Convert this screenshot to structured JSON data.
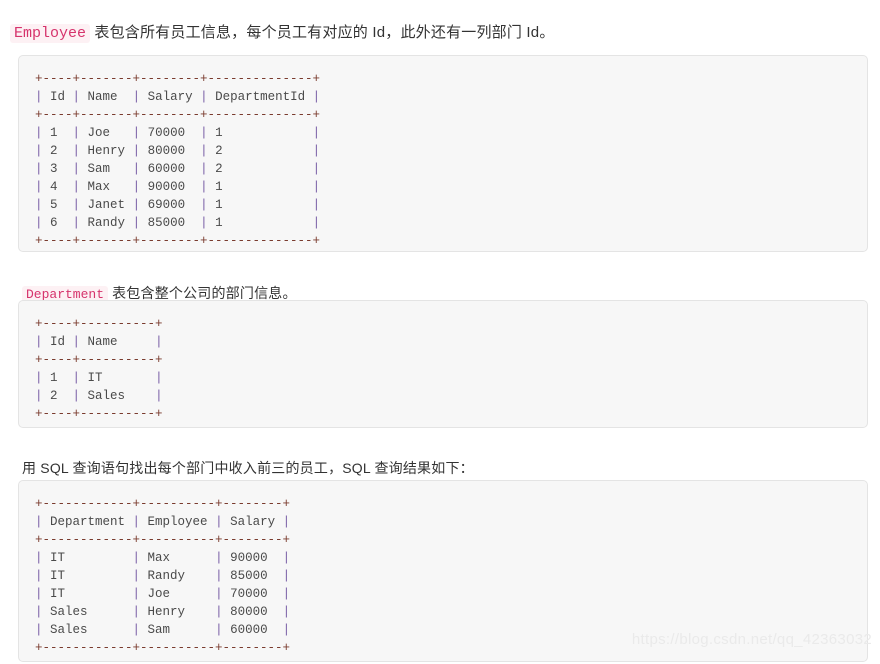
{
  "paragraphs": {
    "employee_intro": {
      "code_token": "Employee",
      "text": " 表包含所有员工信息，每个员工有对应的 Id，此外还有一列部门 Id。"
    },
    "department_intro": {
      "code_token": "Department",
      "text": " 表包含整个公司的部门信息。"
    },
    "query_intro": {
      "text": "用 SQL 查询语句找出每个部门中收入前三的员工，SQL 查询结果如下："
    }
  },
  "code_blocks": {
    "employee_table": {
      "lines": [
        "+----+-------+--------+--------------+",
        "| Id | Name  | Salary | DepartmentId |",
        "+----+-------+--------+--------------+",
        "| 1  | Joe   | 70000  | 1            |",
        "| 2  | Henry | 80000  | 2            |",
        "| 3  | Sam   | 60000  | 2            |",
        "| 4  | Max   | 90000  | 1            |",
        "| 5  | Janet | 69000  | 1            |",
        "| 6  | Randy | 85000  | 1            |",
        "+----+-------+--------+--------------+"
      ],
      "columns": [
        "Id",
        "Name",
        "Salary",
        "DepartmentId"
      ],
      "rows": [
        [
          "1",
          "Joe",
          "70000",
          "1"
        ],
        [
          "2",
          "Henry",
          "80000",
          "2"
        ],
        [
          "3",
          "Sam",
          "60000",
          "2"
        ],
        [
          "4",
          "Max",
          "90000",
          "1"
        ],
        [
          "5",
          "Janet",
          "69000",
          "1"
        ],
        [
          "6",
          "Randy",
          "85000",
          "1"
        ]
      ]
    },
    "department_table": {
      "lines": [
        "+----+----------+",
        "| Id | Name     |",
        "+----+----------+",
        "| 1  | IT       |",
        "| 2  | Sales    |",
        "+----+----------+"
      ],
      "columns": [
        "Id",
        "Name"
      ],
      "rows": [
        [
          "1",
          "IT"
        ],
        [
          "2",
          "Sales"
        ]
      ]
    },
    "result_table": {
      "lines": [
        "+------------+----------+--------+",
        "| Department | Employee | Salary |",
        "+------------+----------+--------+",
        "| IT         | Max      | 90000  |",
        "| IT         | Randy    | 85000  |",
        "| IT         | Joe      | 70000  |",
        "| Sales      | Henry    | 80000  |",
        "| Sales      | Sam      | 60000  |",
        "+------------+----------+--------+"
      ],
      "columns": [
        "Department",
        "Employee",
        "Salary"
      ],
      "rows": [
        [
          "IT",
          "Max",
          "90000"
        ],
        [
          "IT",
          "Randy",
          "85000"
        ],
        [
          "IT",
          "Joe",
          "70000"
        ],
        [
          "Sales",
          "Henry",
          "80000"
        ],
        [
          "Sales",
          "Sam",
          "60000"
        ]
      ]
    }
  },
  "watermark": {
    "text": "https://blog.csdn.net/qq_42363032"
  },
  "colors": {
    "code_background": "#f7f7f7",
    "code_border": "#e4e4e4",
    "inline_code_text": "#d6336c",
    "inline_code_background": "#fdf1f4",
    "body_text": "#333333",
    "ascii_border": "#7a3b2e",
    "ascii_pipe": "#7b61a8",
    "watermark_text": "#eaeaea"
  }
}
